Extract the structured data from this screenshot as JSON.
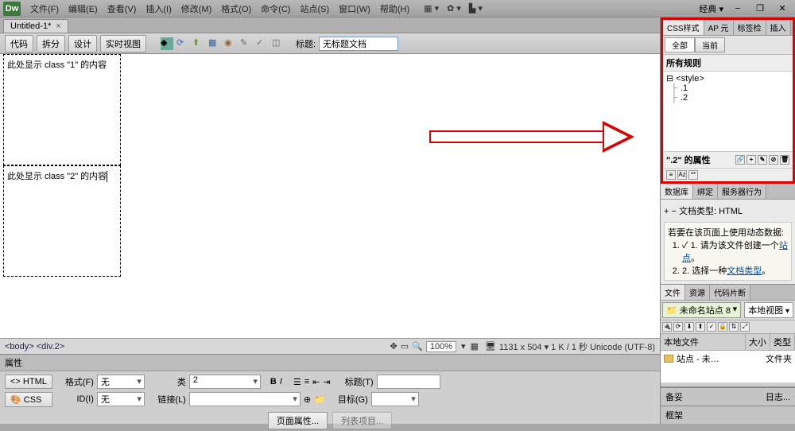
{
  "menubar": {
    "logo": "Dw",
    "items": [
      "文件(F)",
      "编辑(E)",
      "查看(V)",
      "插入(I)",
      "修改(M)",
      "格式(O)",
      "命令(C)",
      "站点(S)",
      "窗口(W)",
      "帮助(H)"
    ],
    "workspace": "经典",
    "sys": {
      "min": "−",
      "max": "❐",
      "close": "✕"
    }
  },
  "doctab": {
    "name": "Untitled-1*",
    "close": "×"
  },
  "toolbar": {
    "views": [
      "代码",
      "拆分",
      "设计",
      "实时视图"
    ],
    "title_label": "标题:",
    "title_value": "无标题文档"
  },
  "canvas": {
    "box1_text": "此处显示 class \"1\" 的内容",
    "box2_text": "此处显示 class \"2\" 的内容"
  },
  "statusbar": {
    "breadcrumb": "<body> <div.2>",
    "zoom": "100%",
    "info": "1131 x 504 ▾ 1 K / 1 秒 Unicode (UTF-8)"
  },
  "props": {
    "panel_title": "属性",
    "html_btn": "<> HTML",
    "css_btn": "🎨 CSS",
    "format_label": "格式(F)",
    "format_value": "无",
    "id_label": "ID(I)",
    "id_value": "无",
    "class_label": "类",
    "class_value": "2",
    "link_label": "链接(L)",
    "title_label": "标题(T)",
    "target_label": "目标(G)",
    "page_props_btn": "页面属性...",
    "list_item_btn": "列表项目..."
  },
  "css_panel": {
    "tabs": [
      "CSS样式",
      "AP 元",
      "标签检",
      "插入"
    ],
    "subtabs": [
      "全部",
      "当前"
    ],
    "rules_header": "所有规则",
    "tree_root": "<style>",
    "tree_children": [
      ".1",
      ".2"
    ],
    "props_header": "\".2\" 的属性"
  },
  "db_panel": {
    "tabs": [
      "数据库",
      "绑定",
      "服务器行为"
    ],
    "doc_type_label": "文档类型: HTML",
    "hint_title": "若要在该页面上使用动态数据:",
    "hint_steps": [
      "请为该文件创建一个<a>站点</a>。",
      "选择一种<a>文档类型</a>。"
    ]
  },
  "files_panel": {
    "tabs": [
      "文件",
      "资源",
      "代码片断"
    ],
    "site": "未命名站点 8",
    "view": "本地视图",
    "cols": {
      "name": "本地文件",
      "size": "大小",
      "type": "类型"
    },
    "row": {
      "name": "站点 - 未…",
      "type": "文件夹"
    }
  },
  "bottom_panels": {
    "beibei": "备妥",
    "rizhi": "日志...",
    "kuangjia": "框架"
  }
}
